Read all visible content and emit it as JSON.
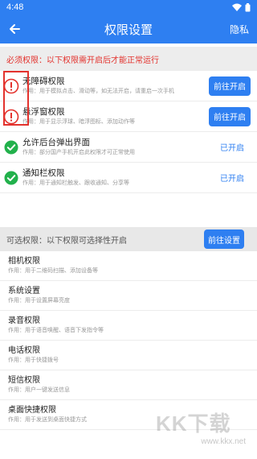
{
  "status_bar": {
    "time": "4:48"
  },
  "app_bar": {
    "title": "权限设置",
    "privacy": "隐私"
  },
  "required": {
    "header": "必须权限：以下权限需开启后才能正常运行",
    "items": [
      {
        "title": "无障碍权限",
        "desc": "作用：用于模拟点击、滑动等，如无法开启，请重启一次手机",
        "state": "warn",
        "action": "前往开启"
      },
      {
        "title": "悬浮窗权限",
        "desc": "作用：用于显示浮球、暗浮图标、添加动作等",
        "state": "warn",
        "action": "前往开启"
      },
      {
        "title": "允许后台弹出界面",
        "desc": "作用：部分国产手机开启此权限才可正常使用",
        "state": "ok",
        "status": "已开启"
      },
      {
        "title": "通知栏权限",
        "desc": "作用：用于通知栏触发、跟收通知、分享等",
        "state": "ok",
        "status": "已开启"
      }
    ]
  },
  "optional": {
    "header": "可选权限：以下权限可选择性开启",
    "action": "前往设置",
    "items": [
      {
        "title": "相机权限",
        "desc": "作用：用于二维码扫描、添加设备等"
      },
      {
        "title": "系统设置",
        "desc": "作用：用于设置屏幕亮度"
      },
      {
        "title": "录音权限",
        "desc": "作用：用于语音唤醒、语音下发指令等"
      },
      {
        "title": "电话权限",
        "desc": "作用：用于快捷拨号"
      },
      {
        "title": "短信权限",
        "desc": "作用：用户一键发送信息"
      },
      {
        "title": "桌面快捷权限",
        "desc": "作用：用于发送到桌面快捷方式"
      }
    ]
  },
  "watermark": {
    "text": "KK下载",
    "url": "www.kkx.net"
  },
  "colors": {
    "primary": "#2e7ff1",
    "warning": "#e3322d",
    "success": "#22b14c"
  }
}
